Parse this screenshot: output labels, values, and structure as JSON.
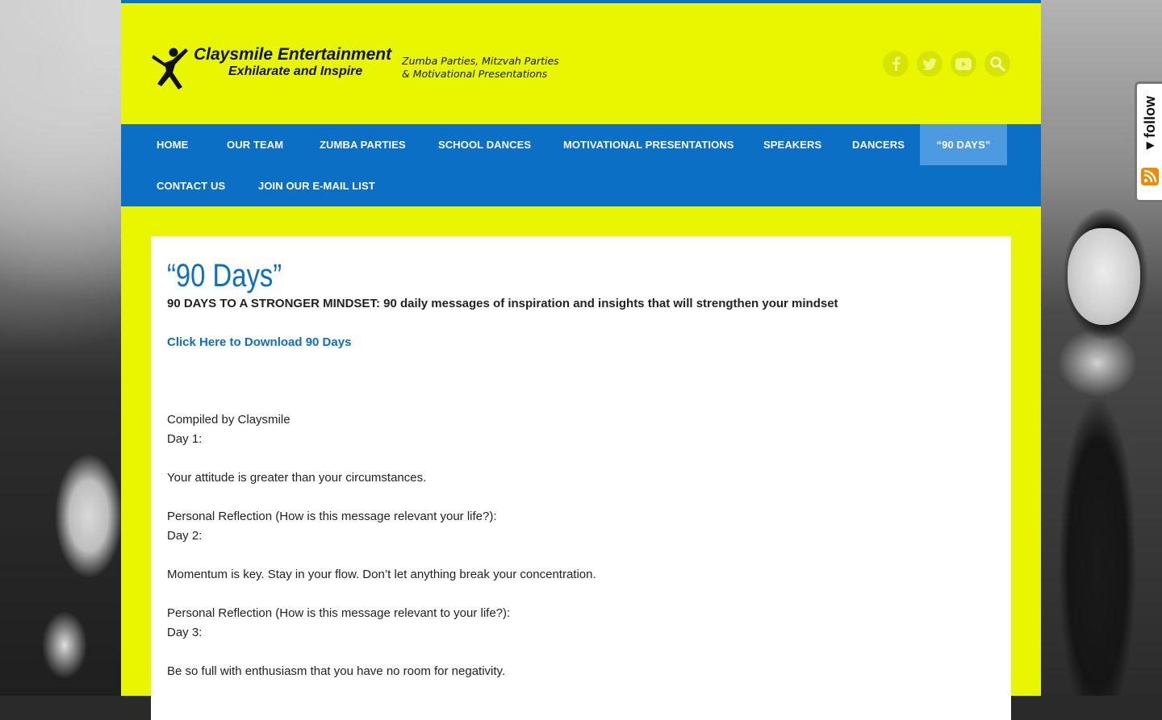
{
  "brand": {
    "name": "Claysmile Entertainment",
    "slogan": "Exhilarate and Inspire",
    "tagline_line1": "Zumba Parties, Mitzvah Parties",
    "tagline_line2": "& Motivational Presentations"
  },
  "social": {
    "facebook": "facebook-icon",
    "twitter": "twitter-icon",
    "youtube": "youtube-icon",
    "search": "search-icon"
  },
  "nav": {
    "items": [
      {
        "label": "Home"
      },
      {
        "label": "Our Team"
      },
      {
        "label": "Zumba Parties"
      },
      {
        "label": "School Dances"
      },
      {
        "label": "Motivational Presentations"
      },
      {
        "label": "Speakers"
      },
      {
        "label": "Dancers"
      },
      {
        "label": "“90 Days”"
      },
      {
        "label": "Contact Us"
      },
      {
        "label": "Join Our E-mail List"
      }
    ],
    "active_index": 7
  },
  "main": {
    "title": "“90 Days”",
    "lead": "90 DAYS TO A STRONGER MINDSET: 90 daily messages of inspiration and insights that will strengthen your mindset",
    "download_link": "Click Here to Download 90 Days",
    "compiled_by": "Compiled by Claysmile",
    "day1_label": "Day 1:",
    "day1_message": "Your attitude is greater than your circumstances.",
    "day1_reflection": "Personal Reflection (How is this message relevant your life?):",
    "day2_label": "Day 2:",
    "day2_message": "Momentum is key.  Stay in your flow.  Don’t let anything break your concentration.",
    "day2_reflection": "Personal Reflection (How is this message relevant to your life?):",
    "day3_label": "Day 3:",
    "day3_message": "Be so full with enthusiasm that you have no room for negativity."
  },
  "follow_widget": {
    "label": "◂follow"
  },
  "colors": {
    "page_bg": "#e8f600",
    "nav_bg": "#0b6fc5",
    "nav_active": "#4d9ae0",
    "title": "#0b6fc5",
    "rss": "#f08a00"
  }
}
